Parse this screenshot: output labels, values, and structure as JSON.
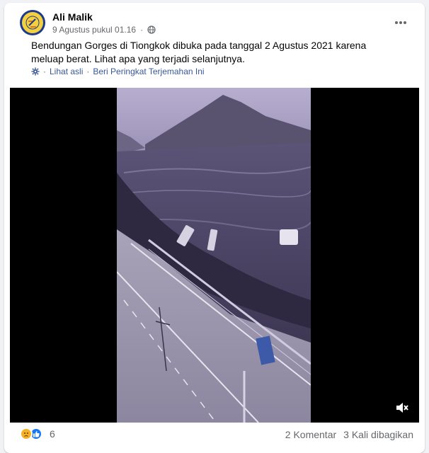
{
  "post": {
    "author": "Ali Malik",
    "timestamp": "9 Agustus pukul 01.16",
    "text": "Bendungan Gorges di Tiongkok dibuka pada tanggal 2 Agustus 2021 karena meluap berat. Lihat apa yang terjadi selanjutnya.",
    "translation": {
      "see_original": "Lihat asli",
      "separator": "·",
      "rate_translation": "Beri Peringkat Terjemahan Ini"
    }
  },
  "footer": {
    "reaction_count": "6",
    "comments": "2 Komentar",
    "shares": "3 Kali dibagikan"
  },
  "icons": {
    "privacy": "public-globe-icon",
    "more": "more-options-icon",
    "translate": "translate-gear-icon",
    "mute": "muted-speaker-icon",
    "reaction_1": "sad-reaction-icon",
    "reaction_2": "like-reaction-icon"
  },
  "colors": {
    "link": "#385898",
    "secondary_text": "#65676b",
    "like_blue": "#1877f2",
    "sad_yellow": "#f7b125"
  }
}
